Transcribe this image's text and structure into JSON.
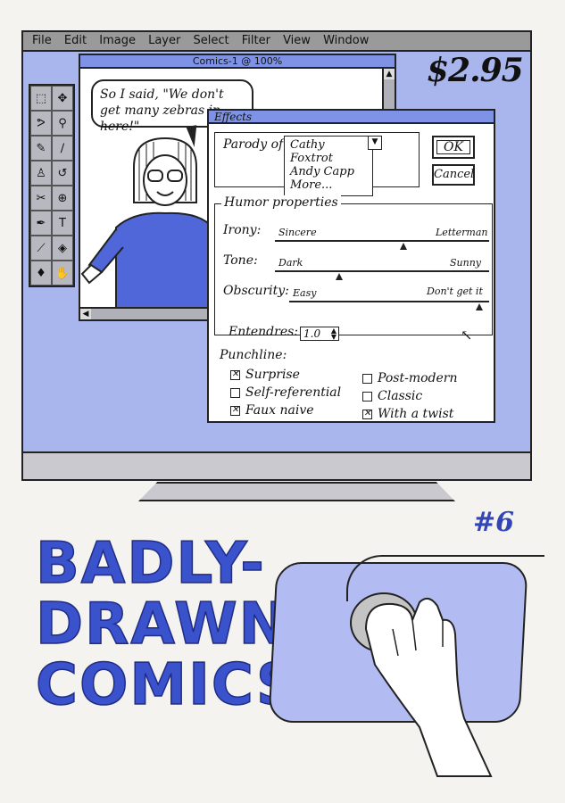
{
  "menubar": {
    "items": [
      "File",
      "Edit",
      "Image",
      "Layer",
      "Select",
      "Filter",
      "View",
      "Window"
    ]
  },
  "price": "$2.95",
  "document": {
    "title": "Comics-1 @ 100%",
    "speech": "So I said, \"We don't get many zebras in here!\""
  },
  "toolbox": {
    "tools": [
      "marquee-icon",
      "move-icon",
      "lasso-icon",
      "magic-wand-icon",
      "pencil-icon",
      "brush-icon",
      "stamp-icon",
      "history-brush-icon",
      "eraser-icon",
      "zoom-icon",
      "pen-icon",
      "type-icon",
      "line-icon",
      "fill-icon",
      "dodge-icon",
      "hand-icon"
    ]
  },
  "effects": {
    "title": "Effects",
    "parody_label": "Parody of:",
    "parody_options": [
      "Cathy",
      "Foxtrot",
      "Andy Capp",
      "More..."
    ],
    "ok_label": "OK",
    "cancel_label": "Cancel",
    "humor_label": "Humor properties",
    "irony": {
      "label": "Irony:",
      "min": "Sincere",
      "max": "Letterman",
      "value": 0.6
    },
    "tone": {
      "label": "Tone:",
      "min": "Dark",
      "max": "Sunny",
      "value": 0.3
    },
    "obscurity": {
      "label": "Obscurity:",
      "min": "Easy",
      "max": "Don't get it",
      "value": 0.95
    },
    "entendres": {
      "label": "Entendres:",
      "value": "1.0"
    },
    "punchline_label": "Punchline:",
    "punchlines": [
      {
        "label": "Surprise",
        "checked": true
      },
      {
        "label": "Self-referential",
        "checked": false
      },
      {
        "label": "Faux naive",
        "checked": true
      },
      {
        "label": "Post-modern",
        "checked": false
      },
      {
        "label": "Classic",
        "checked": false
      },
      {
        "label": "With a twist",
        "checked": true
      }
    ]
  },
  "cover": {
    "issue": "#6",
    "title_lines": [
      "BADLY-",
      "DRAWN",
      "COMICS"
    ]
  },
  "colors": {
    "accent": "#3a52cc",
    "screen": "#a9b6ee",
    "titlebar": "#7f93e6"
  }
}
